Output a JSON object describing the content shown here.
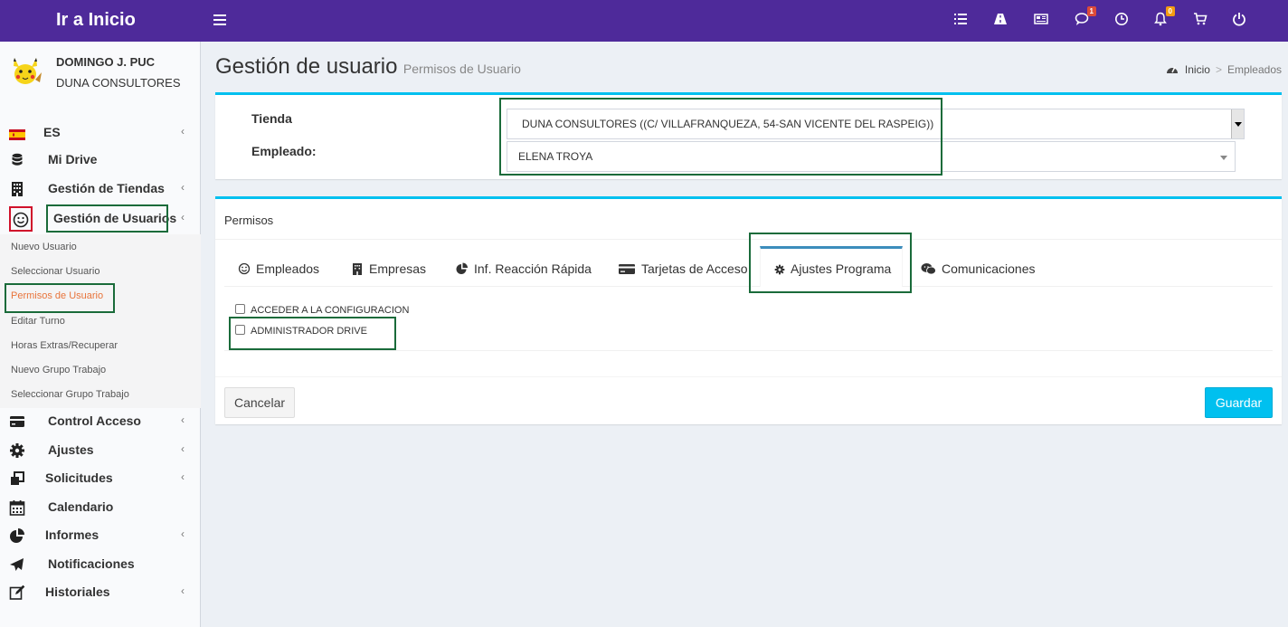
{
  "brand": "Ir a Inicio",
  "header_badges": {
    "messages": "1",
    "notifications": "0"
  },
  "colors": {
    "topbar": "#4e2a9a",
    "accent": "#00c0ef",
    "active_subitem": "#e8743b",
    "highlight_green": "#1a6b3a",
    "highlight_red": "#d0112b"
  },
  "user": {
    "name": "DOMINGO J. PUC",
    "company": "DUNA CONSULTORES"
  },
  "sidebar": {
    "language": "ES",
    "items": [
      {
        "label": "Mi Drive",
        "icon": "database-icon"
      },
      {
        "label": "Gestión de Tiendas",
        "icon": "building-icon"
      },
      {
        "label": "Gestión de Usuarios",
        "icon": "smile-icon"
      },
      {
        "label": "Control Acceso",
        "icon": "credit-card-icon"
      },
      {
        "label": "Ajustes",
        "icon": "gear-icon"
      },
      {
        "label": "Solicitudes",
        "icon": "clone-icon"
      },
      {
        "label": "Calendario",
        "icon": "calendar-icon"
      },
      {
        "label": "Informes",
        "icon": "pie-chart-icon"
      },
      {
        "label": "Notificaciones",
        "icon": "paper-plane-icon"
      },
      {
        "label": "Historiales",
        "icon": "edit-icon"
      }
    ],
    "sub_items": [
      "Nuevo Usuario",
      "Seleccionar Usuario",
      "Permisos de Usuario",
      "Editar Turno",
      "Horas Extras/Recuperar",
      "Nuevo Grupo Trabajo",
      "Seleccionar Grupo Trabajo"
    ]
  },
  "page": {
    "title": "Gestión de usuario",
    "subtitle": "Permisos de Usuario"
  },
  "breadcrumb": {
    "home": "Inicio",
    "current": "Empleados"
  },
  "form": {
    "tienda_label": "Tienda",
    "tienda_value": "DUNA CONSULTORES ((C/ VILLAFRANQUEZA, 54-SAN VICENTE DEL RASPEIG))",
    "empleado_label": "Empleado:",
    "empleado_value": "ELENA TROYA"
  },
  "permisos": {
    "title": "Permisos",
    "tabs": [
      "Empleados",
      "Empresas",
      "Inf. Reacción Rápida",
      "Tarjetas de Acceso",
      "Ajustes Programa",
      "Comunicaciones"
    ],
    "active_tab": "Ajustes Programa",
    "checkboxes": [
      {
        "label": "ACCEDER A LA CONFIGURACION",
        "checked": false
      },
      {
        "label": "ADMINISTRADOR DRIVE",
        "checked": false
      }
    ],
    "cancel_label": "Cancelar",
    "save_label": "Guardar"
  }
}
